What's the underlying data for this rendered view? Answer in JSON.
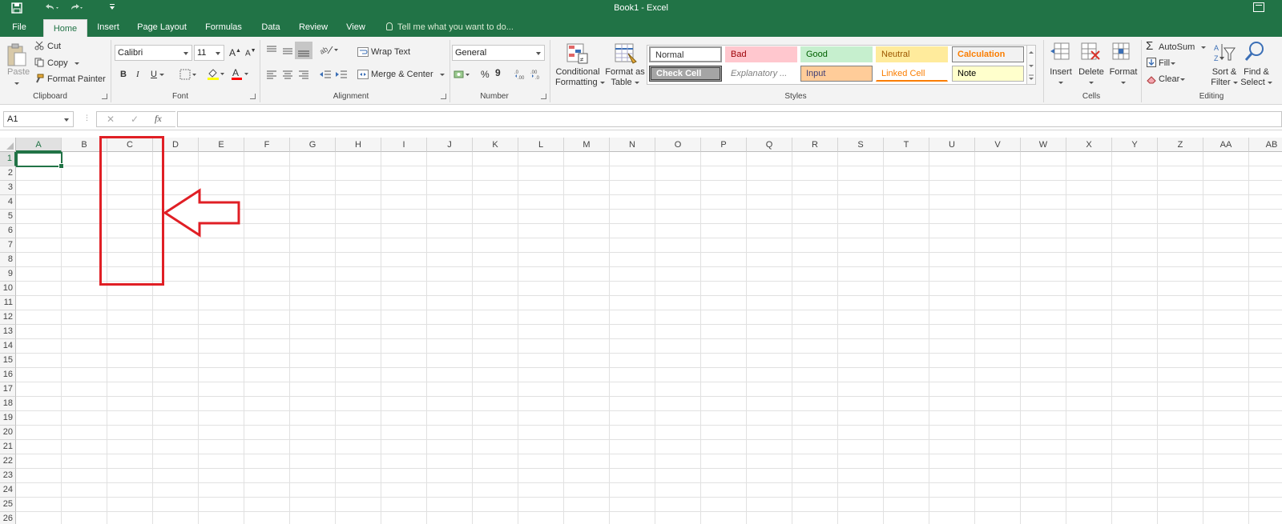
{
  "titlebar": {
    "title": "Book1 - Excel",
    "accent": "#217346"
  },
  "tabs": [
    {
      "label": "File",
      "active": false
    },
    {
      "label": "Home",
      "active": true
    },
    {
      "label": "Insert",
      "active": false
    },
    {
      "label": "Page Layout",
      "active": false
    },
    {
      "label": "Formulas",
      "active": false
    },
    {
      "label": "Data",
      "active": false
    },
    {
      "label": "Review",
      "active": false
    },
    {
      "label": "View",
      "active": false
    }
  ],
  "tellme": "Tell me what you want to do...",
  "ribbon": {
    "clipboard": {
      "paste": "Paste",
      "cut": "Cut",
      "copy": "Copy",
      "format_painter": "Format Painter",
      "label": "Clipboard"
    },
    "font": {
      "family": "Calibri",
      "size": "11",
      "bold": "B",
      "italic": "I",
      "underline": "U",
      "label": "Font"
    },
    "alignment": {
      "wrap_text": "Wrap Text",
      "merge_center": "Merge & Center",
      "label": "Alignment"
    },
    "number": {
      "format": "General",
      "percent": "%",
      "comma": "9",
      "label": "Number"
    },
    "styles": {
      "conditional_formatting": [
        "Conditional",
        "Formatting"
      ],
      "format_as_table": [
        "Format as",
        "Table"
      ],
      "cells": [
        {
          "label": "Normal",
          "bg": "#ffffff",
          "color": "#000000"
        },
        {
          "label": "Bad",
          "bg": "#ffc7ce",
          "color": "#9c0006"
        },
        {
          "label": "Good",
          "bg": "#c6efce",
          "color": "#006100"
        },
        {
          "label": "Neutral",
          "bg": "#ffeb9c",
          "color": "#9c5700"
        },
        {
          "label": "Calculation",
          "bg": "#f2f2f2",
          "color": "#fa7d00"
        },
        {
          "label": "Check Cell",
          "bg": "#a5a5a5",
          "color": "#ffffff"
        },
        {
          "label": "Explanatory ...",
          "bg": "#ffffff",
          "color": "#7f7f7f"
        },
        {
          "label": "Input",
          "bg": "#ffcc99",
          "color": "#3f3f76"
        },
        {
          "label": "Linked Cell",
          "bg": "#ffffff",
          "color": "#fa7d00"
        },
        {
          "label": "Note",
          "bg": "#ffffcc",
          "color": "#000000"
        }
      ],
      "label": "Styles"
    },
    "cells": {
      "insert": "Insert",
      "delete": "Delete",
      "format": "Format",
      "label": "Cells"
    },
    "editing": {
      "autosum": "AutoSum",
      "fill": "Fill",
      "clear": "Clear",
      "sort_filter": [
        "Sort &",
        "Filter"
      ],
      "find_select": [
        "Find &",
        "Select"
      ],
      "label": "Editing"
    }
  },
  "formula_bar": {
    "name_box": "A1",
    "cancel": "✕",
    "enter": "✓",
    "fx": "fx",
    "value": ""
  },
  "grid": {
    "columns": [
      "A",
      "B",
      "C",
      "D",
      "E",
      "F",
      "G",
      "H",
      "I",
      "J",
      "K",
      "L",
      "M",
      "N",
      "O",
      "P",
      "Q",
      "R",
      "S",
      "T",
      "U",
      "V",
      "W",
      "X",
      "Y",
      "Z",
      "AA",
      "AB"
    ],
    "rows": [
      "1",
      "2",
      "3",
      "4",
      "5",
      "6",
      "7",
      "8",
      "9",
      "10",
      "11",
      "12",
      "13",
      "14",
      "15",
      "16",
      "17",
      "18",
      "19",
      "20",
      "21",
      "22",
      "23",
      "24",
      "25",
      "26"
    ],
    "active_cell": "A1"
  },
  "annotation": {
    "color": "#e01f25",
    "target_column": "C"
  }
}
